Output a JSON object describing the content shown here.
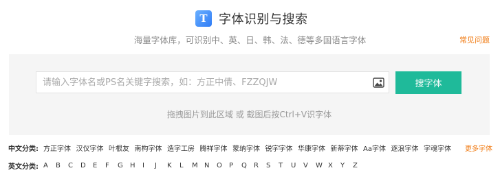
{
  "header": {
    "logo_letter": "T",
    "title": "字体识别与搜索",
    "subtitle": "海量字体库，可识别中、英、日、韩、法、德等多国语言字体",
    "faq_link": "常见问题"
  },
  "search": {
    "placeholder": "请输入字体名或PS名关键字搜索，如：方正中倩、FZZQJW",
    "value": "",
    "button_label": "搜字体",
    "drop_hint": "拖拽图片到此区域 或 截图后按Ctrl+V识字体",
    "image_icon": "image-icon"
  },
  "chinese_categories": {
    "label": "中文分类:",
    "items": [
      "方正字体",
      "汉仪字体",
      "叶根友",
      "南构字体",
      "造字工房",
      "腾祥字体",
      "蒙纳字体",
      "锐字字体",
      "华康字体",
      "新蒂字体",
      "Aa字体",
      "逐浪字体",
      "字魂字体"
    ],
    "more": "更多字体"
  },
  "english_categories": {
    "label": "英文分类:",
    "letters": [
      "A",
      "B",
      "C",
      "D",
      "E",
      "F",
      "G",
      "H",
      "I",
      "J",
      "K",
      "L",
      "M",
      "N",
      "O",
      "P",
      "Q",
      "R",
      "S",
      "T",
      "U",
      "V",
      "W",
      "X",
      "Y",
      "Z"
    ]
  },
  "colors": {
    "accent_green": "#1fba9a",
    "accent_orange": "#f07a12",
    "panel_bg": "#f5f5f5"
  }
}
